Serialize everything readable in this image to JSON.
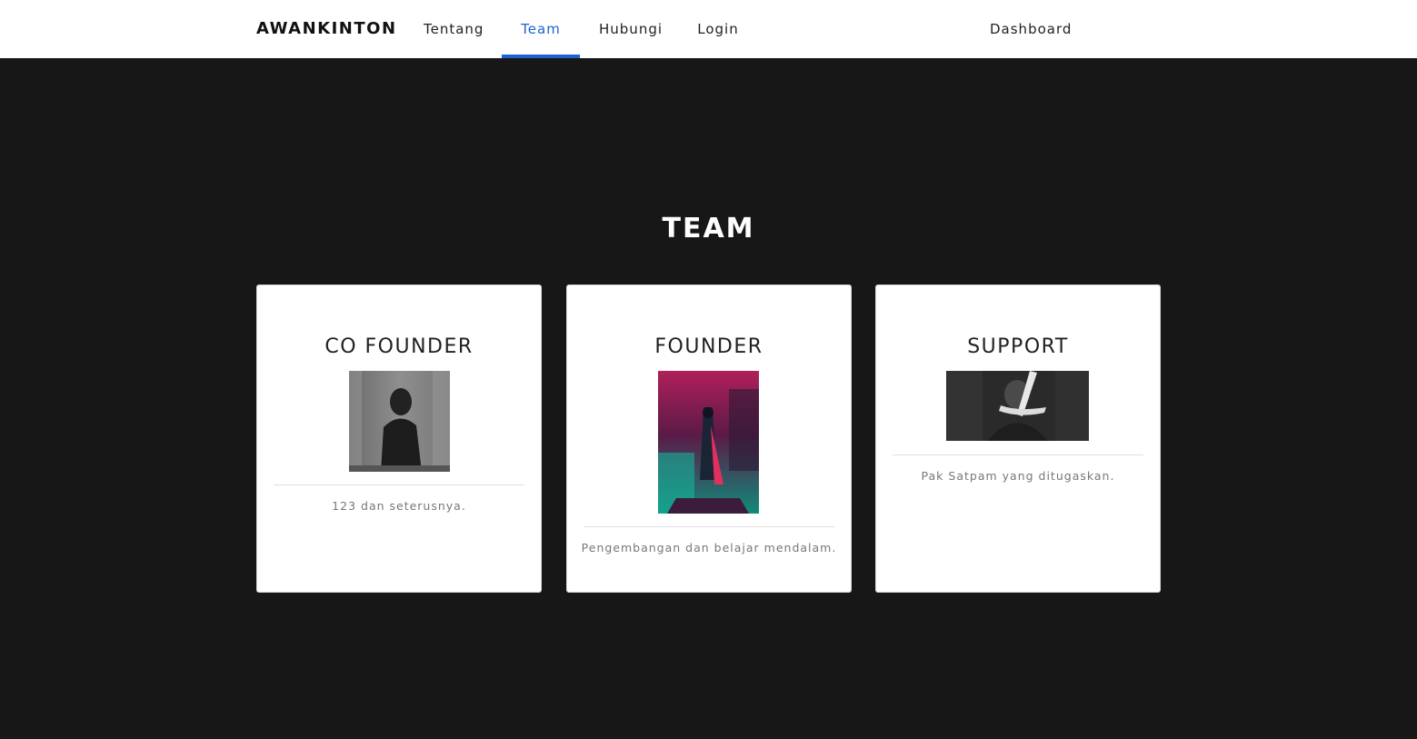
{
  "navbar": {
    "brand": "AWANKINTON",
    "items": [
      {
        "label": "Tentang",
        "active": false
      },
      {
        "label": "Team",
        "active": true
      },
      {
        "label": "Hubungi",
        "active": false
      },
      {
        "label": "Login",
        "active": false
      }
    ],
    "right_link": "Dashboard"
  },
  "team": {
    "title": "TEAM",
    "members": [
      {
        "role": "CO FOUNDER",
        "description": "123 dan seterusnya."
      },
      {
        "role": "FOUNDER",
        "description": "Pengembangan dan belajar mendalam."
      },
      {
        "role": "SUPPORT",
        "description": "Pak Satpam yang ditugaskan."
      }
    ]
  },
  "colors": {
    "accent": "#1e62d0",
    "background": "#171717",
    "card": "#ffffff"
  }
}
